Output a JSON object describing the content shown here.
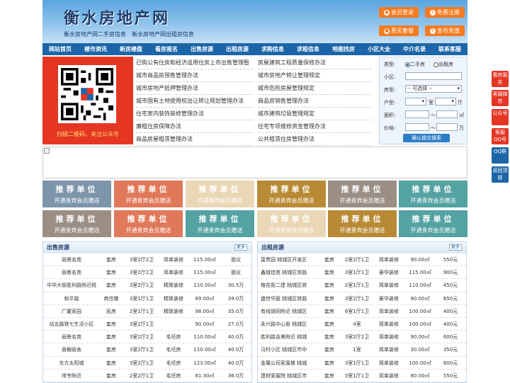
{
  "header": {
    "title": "衡水房地产网",
    "slogan": "衡水房地产网二手房信息　衡水房地产网出租房信息",
    "buttons": [
      "会员登录",
      "免费注册",
      "费买套餐",
      "金币充值"
    ]
  },
  "nav": [
    "网站首页",
    "楼市资讯",
    "新房楼盘",
    "看房报名",
    "出售房源",
    "出租房源",
    "求购信息",
    "求租信息",
    "地图找房",
    "小区大全",
    "中介名录",
    "联系客服"
  ],
  "qr": {
    "caption": "扫描二维码，关注公众号"
  },
  "links": [
    [
      "已购公有住房和经济适用住房上市出售管理暂",
      "房屋建筑工程质量保修办法"
    ],
    [
      "城市商品房预售管理办法",
      "城市房地产转让管理规定"
    ],
    [
      "城市房地产抵押管理办法",
      "城市危险房屋管理规定"
    ],
    [
      "城市国有土地使用权出让转让规划管理办法",
      "商品房销售管理办法"
    ],
    [
      "住宅室内装饰装修管理办法",
      "城市建筑垃圾管理规定"
    ],
    [
      "廉租住房保障办法",
      "住宅专项维修资金管理办法"
    ],
    [
      "商品房屋租赁管理办法",
      "公共租赁住房管理办法"
    ]
  ],
  "search": {
    "type_label": "类型:",
    "opt_sale": "二手房",
    "opt_rent": "出租房",
    "community_label": "小区:",
    "kind_label": "房型:",
    "kind_value": "-- 可选择 --",
    "layout_label": "户型:",
    "room": "室",
    "hall": "厅",
    "area_label": "面积:",
    "area_to": "～",
    "area_unit": "㎡",
    "price_label": "价格:",
    "price_to": "～",
    "price_unit": "万",
    "submit": "确认提交搜索"
  },
  "side": [
    "看房报名",
    "客服微信",
    "公众号",
    "客服QQ号",
    "QQ群",
    "返回顶部"
  ],
  "tiles": {
    "t1": "推荐单位",
    "t2": "开通贵宾会员赠送",
    "colors": [
      "#7d95ab",
      "#e0785a",
      "#ead7b6",
      "#b98a35",
      "#9b8f85",
      "#54a2a2",
      "#9b8f85",
      "#e0785a",
      "#54a2a2",
      "#ead7b6",
      "#b98a35",
      "#54a2a2"
    ]
  },
  "sale": {
    "title": "出售房源",
    "more": "更多",
    "rows": [
      [
        "丽景名苑",
        "套房",
        "3室2厅2卫",
        "简单装修",
        "115.00㎡",
        "面议"
      ],
      [
        "丽景名苑",
        "套房",
        "3室2厅2卫",
        "简单装修",
        "115.00㎡",
        "面议"
      ],
      [
        "中华大街胜利路附近税",
        "套房",
        "3室2厅1卫",
        "精致装修",
        "110.00㎡",
        "30.5万"
      ],
      [
        "和平路",
        "商住楼",
        "3室1厅1卫",
        "精致装修",
        "89.00㎡",
        "39.0万"
      ],
      [
        "广厦家园",
        "民房",
        "2室1厅1卫",
        "精致装修",
        "98.00㎡",
        "35.0万"
      ],
      [
        "站北路铁七生活小区",
        "套房",
        "3室2厅1卫",
        "",
        "90.00㎡",
        "27.0万"
      ],
      [
        "丽景名苑",
        "套房",
        "3室2厅2卫",
        "毛坯房",
        "110.00㎡",
        "40.0万"
      ],
      [
        "香榭丽舍",
        "套房",
        "3室2厅1卫",
        "毛坯房",
        "110.00㎡",
        "40.0万"
      ],
      [
        "东方太阳城",
        "套房",
        "3室2厅1卫",
        "毛坯房",
        "123.00㎡",
        "40.0万"
      ],
      [
        "师专附近",
        "套房",
        "2室2厅1卫",
        "毛坯房",
        "81.30㎡",
        "36.0万"
      ]
    ]
  },
  "rent": {
    "title": "出租房源",
    "more": "更多",
    "rows": [
      [
        "富贵园 桃城区开发区",
        "套房",
        "2室2厅1卫",
        "简单装修",
        "90.00㎡",
        "550元"
      ],
      [
        "鑫城佳苑 桃城区铁路",
        "套房",
        "3室1厅1卫",
        "豪华装修",
        "115.00㎡",
        "900元"
      ],
      [
        "榕花街二建 桃城区铁",
        "套房",
        "2室1厅1卫",
        "简单装修",
        "110.00㎡",
        "450元"
      ],
      [
        "盛世华庭 桃城区铁路",
        "套房",
        "3室2厅1卫",
        "豪华装修",
        "90.00㎡",
        "650元"
      ],
      [
        "有线胡同附近 桃城区",
        "套房",
        "6室1厅1卫",
        "简单装修",
        "100.00㎡",
        "400元"
      ],
      [
        "永兴路中心街 桃城区",
        "套房",
        "4室",
        "简单装修",
        "100.00㎡",
        "400元"
      ],
      [
        "胜利路吉美附近 桃城",
        "套房",
        "3室2厅2卫",
        "简单装修",
        "90.00㎡",
        "600元"
      ],
      [
        "马村小区 桃城区市中",
        "套房",
        "1室",
        "简单装修",
        "30.00㎡",
        "350元"
      ],
      [
        "金展公司家属楼 桃城",
        "套房",
        "3室1厅1卫",
        "简单装修",
        "100.00㎡",
        "600元"
      ],
      [
        "建材家属院 桃城区市",
        "套房",
        "3室1厅1卫",
        "简单装修",
        "80.00㎡",
        "550元"
      ]
    ]
  }
}
